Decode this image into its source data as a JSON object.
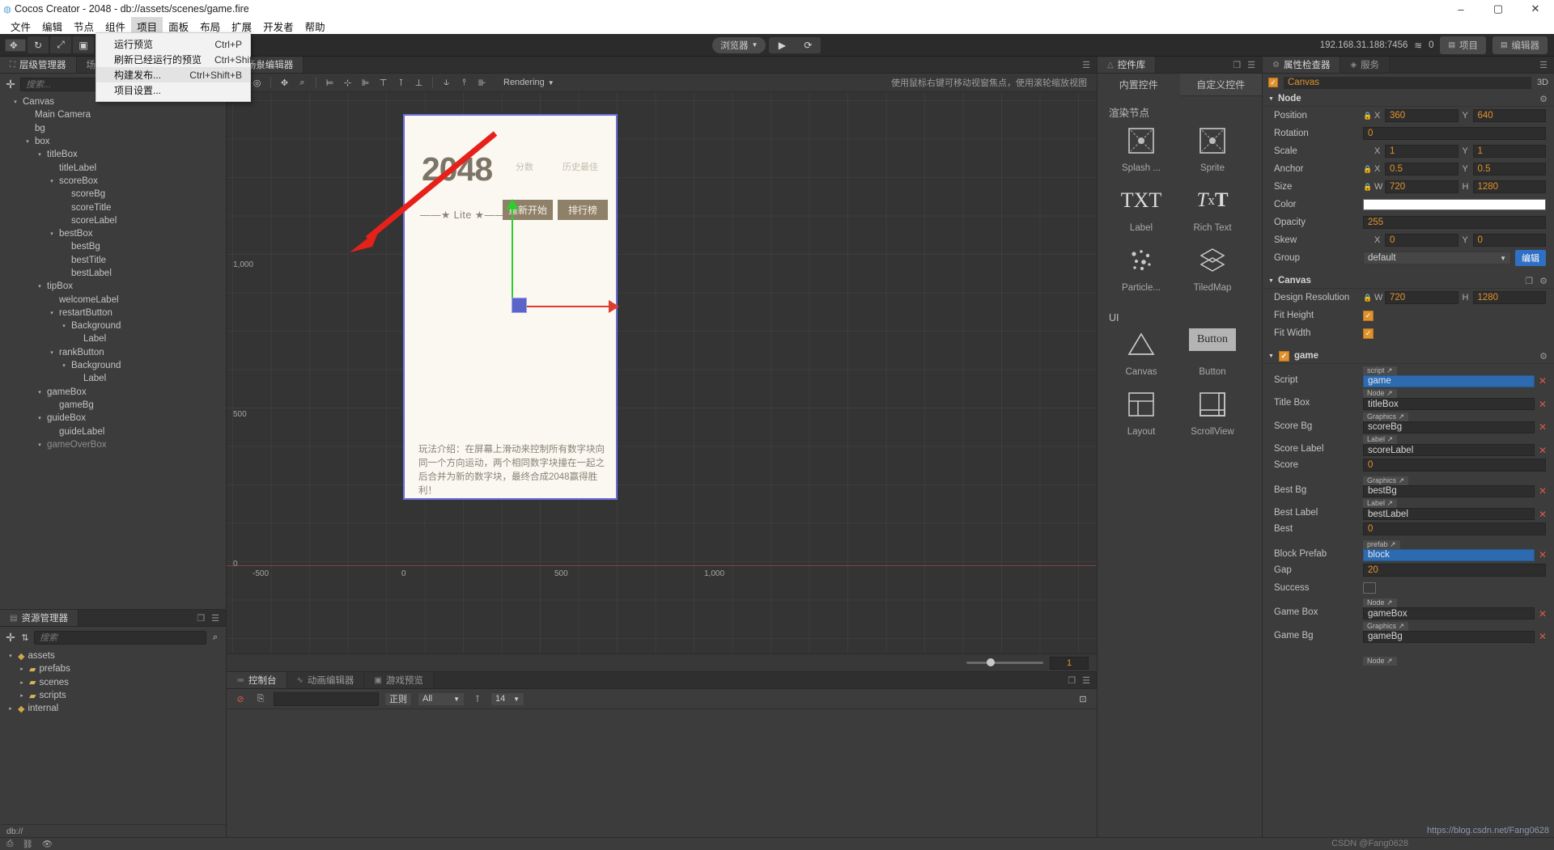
{
  "titlebar": {
    "title": "Cocos Creator - 2048 - db://assets/scenes/game.fire",
    "minimize": "–",
    "maximize": "▢",
    "close": "✕"
  },
  "menubar": {
    "items": [
      "文件",
      "编辑",
      "节点",
      "组件",
      "项目",
      "面板",
      "布局",
      "扩展",
      "开发者",
      "帮助"
    ],
    "active": "项目"
  },
  "dropdown": {
    "items": [
      {
        "label": "运行预览",
        "shortcut": "Ctrl+P"
      },
      {
        "label": "刷新已经运行的预览",
        "shortcut": "Ctrl+Shift+P"
      },
      {
        "label": "构建发布...",
        "shortcut": "Ctrl+Shift+B"
      },
      {
        "label": "项目设置...",
        "shortcut": ""
      }
    ],
    "highlighted": "构建发布..."
  },
  "toolbar": {
    "left_tools": [
      "✥",
      "↻",
      "⤢",
      "▣",
      "⬚"
    ],
    "align_tools": [
      "⊨",
      "⊏",
      "⊐",
      "|",
      "⊢",
      "⊣",
      "⊥",
      "⫝",
      "⫝̸",
      "⊪"
    ],
    "preview_target": "浏览器",
    "play": "▶",
    "refresh": "⟳",
    "address": "192.168.31.188:7456",
    "wifi_icon": "wifi-icon",
    "device_count": "0",
    "tab_project": "项目",
    "tab_editor": "编辑器"
  },
  "hierarchy": {
    "tab": "层级管理器",
    "tab2": "场景编辑器",
    "search_placeholder": "搜索...",
    "nodes": [
      {
        "label": "Canvas",
        "depth": 0,
        "arrow": "▾"
      },
      {
        "label": "Main Camera",
        "depth": 1,
        "arrow": ""
      },
      {
        "label": "bg",
        "depth": 1,
        "arrow": ""
      },
      {
        "label": "box",
        "depth": 1,
        "arrow": "▾"
      },
      {
        "label": "titleBox",
        "depth": 2,
        "arrow": "▾"
      },
      {
        "label": "titleLabel",
        "depth": 3,
        "arrow": ""
      },
      {
        "label": "scoreBox",
        "depth": 3,
        "arrow": "▾"
      },
      {
        "label": "scoreBg",
        "depth": 4,
        "arrow": ""
      },
      {
        "label": "scoreTitle",
        "depth": 4,
        "arrow": ""
      },
      {
        "label": "scoreLabel",
        "depth": 4,
        "arrow": ""
      },
      {
        "label": "bestBox",
        "depth": 3,
        "arrow": "▾"
      },
      {
        "label": "bestBg",
        "depth": 4,
        "arrow": ""
      },
      {
        "label": "bestTitle",
        "depth": 4,
        "arrow": ""
      },
      {
        "label": "bestLabel",
        "depth": 4,
        "arrow": ""
      },
      {
        "label": "tipBox",
        "depth": 2,
        "arrow": "▾"
      },
      {
        "label": "welcomeLabel",
        "depth": 3,
        "arrow": ""
      },
      {
        "label": "restartButton",
        "depth": 3,
        "arrow": "▾"
      },
      {
        "label": "Background",
        "depth": 4,
        "arrow": "▾"
      },
      {
        "label": "Label",
        "depth": 5,
        "arrow": ""
      },
      {
        "label": "rankButton",
        "depth": 3,
        "arrow": "▾"
      },
      {
        "label": "Background",
        "depth": 4,
        "arrow": "▾"
      },
      {
        "label": "Label",
        "depth": 5,
        "arrow": ""
      },
      {
        "label": "gameBox",
        "depth": 2,
        "arrow": "▾"
      },
      {
        "label": "gameBg",
        "depth": 3,
        "arrow": ""
      },
      {
        "label": "guideBox",
        "depth": 2,
        "arrow": "▾"
      },
      {
        "label": "guideLabel",
        "depth": 3,
        "arrow": ""
      },
      {
        "label": "gameOverBox",
        "depth": 2,
        "arrow": "▾"
      }
    ]
  },
  "assets": {
    "tab": "资源管理器",
    "search_placeholder": "搜索",
    "nodes": [
      {
        "label": "assets",
        "depth": 0,
        "arrow": "▾",
        "type": "root"
      },
      {
        "label": "prefabs",
        "depth": 1,
        "arrow": "▸",
        "type": "folder"
      },
      {
        "label": "scenes",
        "depth": 1,
        "arrow": "▸",
        "type": "folder"
      },
      {
        "label": "scripts",
        "depth": 1,
        "arrow": "▸",
        "type": "folder"
      },
      {
        "label": "internal",
        "depth": 0,
        "arrow": "▸",
        "type": "root"
      }
    ]
  },
  "scene": {
    "hint": "使用鼠标右键可移动视窗焦点，使用滚轮缩放视图",
    "ruler": {
      "y_labels": [
        "1,000",
        "500",
        "0"
      ],
      "x_labels": [
        "-500",
        "0",
        "500",
        "1,000"
      ]
    },
    "zoom": "1",
    "game": {
      "title": "2048",
      "subtitle": "——★ Lite ★——",
      "score_title": "分数",
      "best_title": "历史最佳",
      "restart_button": "重新开始",
      "rank_button": "排行榜",
      "description": "玩法介绍：在屏幕上滑动来控制所有数字块向同一个方向运动，两个相同数字块撞在一起之后合并为新的数字块，最终合成2048赢得胜利！"
    }
  },
  "console": {
    "tabs": [
      "控制台",
      "动画编辑器",
      "游戏预览"
    ],
    "active_tab": "控制台",
    "clear_icon": "clear-icon",
    "copy_icon": "copy-icon",
    "filter_label": "正则",
    "level": "All",
    "font_icon": "font-size-icon",
    "font_size": "14"
  },
  "widgets": {
    "tab": "控件库",
    "subtabs": [
      "内置控件",
      "自定义控件"
    ],
    "active_subtab": "内置控件",
    "sections": [
      {
        "title": "渲染节点",
        "items": [
          {
            "label": "Splash ...",
            "icon": "sprite-icon"
          },
          {
            "label": "Sprite",
            "icon": "sprite-icon"
          },
          {
            "label": "Label",
            "icon": "txt-icon"
          },
          {
            "label": "Rich Text",
            "icon": "richtext-icon"
          },
          {
            "label": "Particle...",
            "icon": "particle-icon"
          },
          {
            "label": "TiledMap",
            "icon": "tiledmap-icon"
          }
        ]
      },
      {
        "title": "UI",
        "items": [
          {
            "label": "Canvas",
            "icon": "canvas-icon"
          },
          {
            "label": "Button",
            "icon": "button-icon"
          },
          {
            "label": "Layout",
            "icon": "layout-icon"
          },
          {
            "label": "ScrollView",
            "icon": "scrollview-icon"
          }
        ]
      }
    ],
    "button_face": "Button"
  },
  "inspector": {
    "tab": "属性检查器",
    "tab2": "服务",
    "node_name": "Canvas",
    "mode_3d": "3D",
    "sections": {
      "node": {
        "title": "Node",
        "gear": "gear-icon",
        "rows": [
          {
            "label": "Position",
            "lock": true,
            "x": "360",
            "y": "640"
          },
          {
            "label": "Rotation",
            "single": "0"
          },
          {
            "label": "Scale",
            "x": "1",
            "y": "1"
          },
          {
            "label": "Anchor",
            "lock": true,
            "x": "0.5",
            "y": "0.5"
          },
          {
            "label": "Size",
            "lock": true,
            "w": "720",
            "h": "1280"
          },
          {
            "label": "Color",
            "color": "#ffffff"
          },
          {
            "label": "Opacity",
            "single": "255"
          },
          {
            "label": "Skew",
            "x": "0",
            "y": "0"
          },
          {
            "label": "Group",
            "select": "default",
            "button": "编辑"
          }
        ]
      },
      "canvas": {
        "title": "Canvas",
        "design_resolution_label": "Design Resolution",
        "design_w": "720",
        "design_h": "1280",
        "fit_height_label": "Fit Height",
        "fit_height": true,
        "fit_width_label": "Fit Width",
        "fit_width": true
      },
      "game": {
        "title": "game",
        "enabled": true,
        "rows": [
          {
            "label": "Script",
            "tag": "script",
            "value": "game",
            "kind": "ref"
          },
          {
            "label": "Title Box",
            "tag": "Node",
            "value": "titleBox",
            "kind": "plain"
          },
          {
            "label": "Score Bg",
            "tag": "Graphics",
            "value": "scoreBg",
            "kind": "plain"
          },
          {
            "label": "Score Label",
            "tag": "Label",
            "value": "scoreLabel",
            "kind": "plain"
          },
          {
            "label": "Score",
            "value": "0",
            "kind": "num"
          },
          {
            "label": "Best Bg",
            "tag": "Graphics",
            "value": "bestBg",
            "kind": "plain"
          },
          {
            "label": "Best Label",
            "tag": "Label",
            "value": "bestLabel",
            "kind": "plain"
          },
          {
            "label": "Best",
            "value": "0",
            "kind": "num"
          },
          {
            "label": "Block Prefab",
            "tag": "prefab",
            "value": "block",
            "kind": "ref"
          },
          {
            "label": "Gap",
            "value": "20",
            "kind": "num"
          },
          {
            "label": "Success",
            "kind": "color",
            "color": "#3a3a3a"
          },
          {
            "label": "Game Box",
            "tag": "Node",
            "value": "gameBox",
            "kind": "plain"
          },
          {
            "label": "Game Bg",
            "tag": "Graphics",
            "value": "gameBg",
            "kind": "plain"
          },
          {
            "label": "",
            "tag": "Node",
            "value": "",
            "kind": "tagonly"
          }
        ]
      }
    }
  },
  "statusbar": {
    "path": "db://",
    "icons": [
      "save-icon",
      "link-icon",
      "eye-icon"
    ]
  },
  "watermarks": {
    "right": "https://blog.csdn.net/Fang0628",
    "bottom": "CSDN @Fang0628"
  },
  "colors": {
    "accent": "#e0922c",
    "ref_blue": "#2d6ab0",
    "panel_bg": "#3c3c3c",
    "edit_button": "#2f6fc4"
  }
}
